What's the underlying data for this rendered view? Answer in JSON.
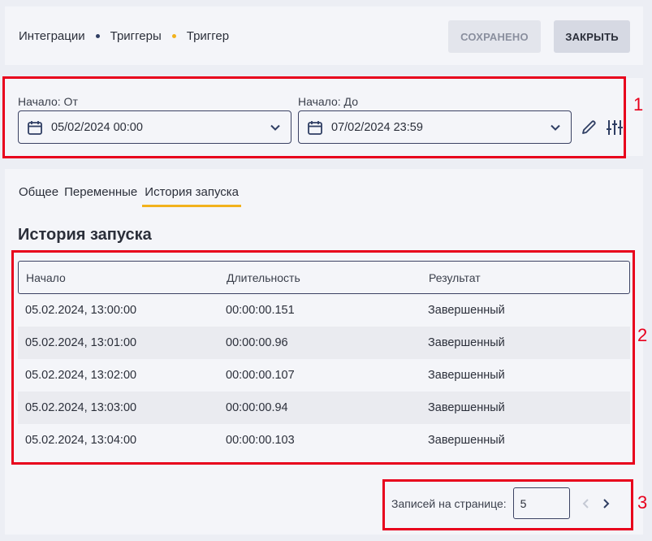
{
  "header": {
    "breadcrumb": [
      "Интеграции",
      "Триггеры",
      "Триггер"
    ],
    "saved_label": "СОХРАНЕНО",
    "close_label": "ЗАКРЫТЬ"
  },
  "filters": {
    "from": {
      "label": "Начало: От",
      "value": "05/02/2024 00:00"
    },
    "to": {
      "label": "Начало: До",
      "value": "07/02/2024 23:59"
    }
  },
  "tabs": [
    {
      "label": "Общее",
      "active": false
    },
    {
      "label": "Переменные",
      "active": false
    },
    {
      "label": "История запуска",
      "active": true
    }
  ],
  "section_title": "История запуска",
  "table": {
    "columns": [
      "Начало",
      "Длительность",
      "Результат"
    ],
    "rows": [
      [
        "05.02.2024, 13:00:00",
        "00:00:00.151",
        "Завершенный"
      ],
      [
        "05.02.2024, 13:01:00",
        "00:00:00.96",
        "Завершенный"
      ],
      [
        "05.02.2024, 13:02:00",
        "00:00:00.107",
        "Завершенный"
      ],
      [
        "05.02.2024, 13:03:00",
        "00:00:00.94",
        "Завершенный"
      ],
      [
        "05.02.2024, 13:04:00",
        "00:00:00.103",
        "Завершенный"
      ]
    ]
  },
  "pagination": {
    "label": "Записей на странице:",
    "per_page": "5"
  },
  "annotations": [
    "1",
    "2",
    "3"
  ],
  "colors": {
    "accent": "#f2b21c",
    "border": "#3b4263",
    "annotation": "#e8001c"
  },
  "icons": [
    "calendar-icon",
    "chevron-down-icon",
    "pencil-icon",
    "sliders-icon",
    "chevron-left-icon",
    "chevron-right-icon"
  ]
}
